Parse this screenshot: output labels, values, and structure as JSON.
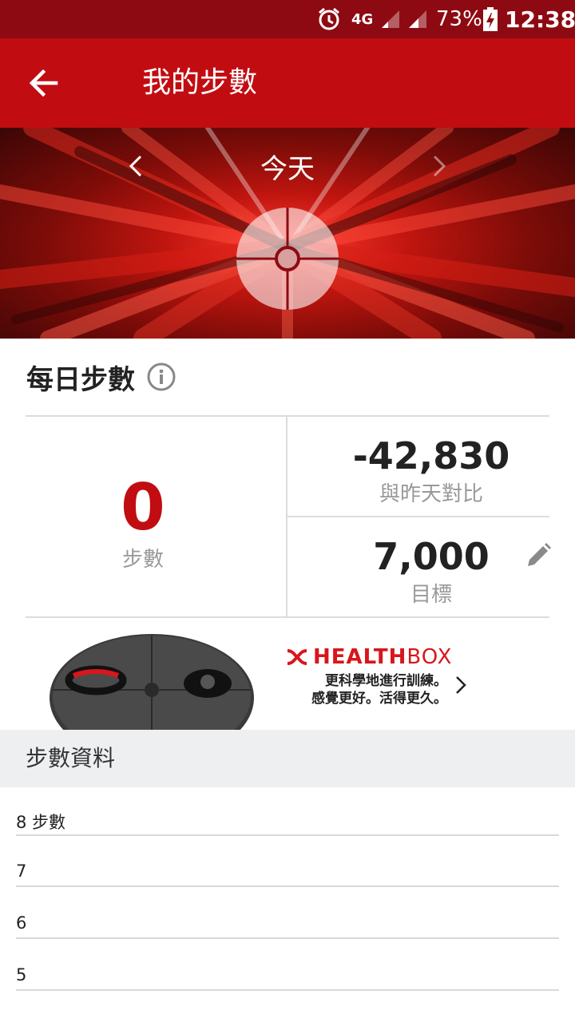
{
  "status_bar": {
    "network": "4G",
    "battery_percent": "73%",
    "time": "12:38"
  },
  "app_bar": {
    "title": "我的步數",
    "back_icon": "arrow-back-icon"
  },
  "hero": {
    "date_label": "今天",
    "prev_icon": "chevron-left-icon",
    "next_icon": "chevron-right-icon"
  },
  "daily_steps": {
    "title": "每日步數",
    "steps_value": "0",
    "steps_label": "步數",
    "comparison_value": "-42,830",
    "comparison_label": "與昨天對比",
    "goal_value": "7,000",
    "goal_label": "目標"
  },
  "ad": {
    "brand_bold": "HEALTH",
    "brand_light": "BOX",
    "line1": "更科學地進行訓練。",
    "line2": "感覺更好。活得更久。"
  },
  "step_data": {
    "header": "步數資料",
    "axis_labels": [
      "8 步數",
      "7",
      "6",
      "5"
    ]
  },
  "colors": {
    "primary": "#c10d12",
    "status_bar": "#8e0a12",
    "accent_red": "#d8161c"
  }
}
